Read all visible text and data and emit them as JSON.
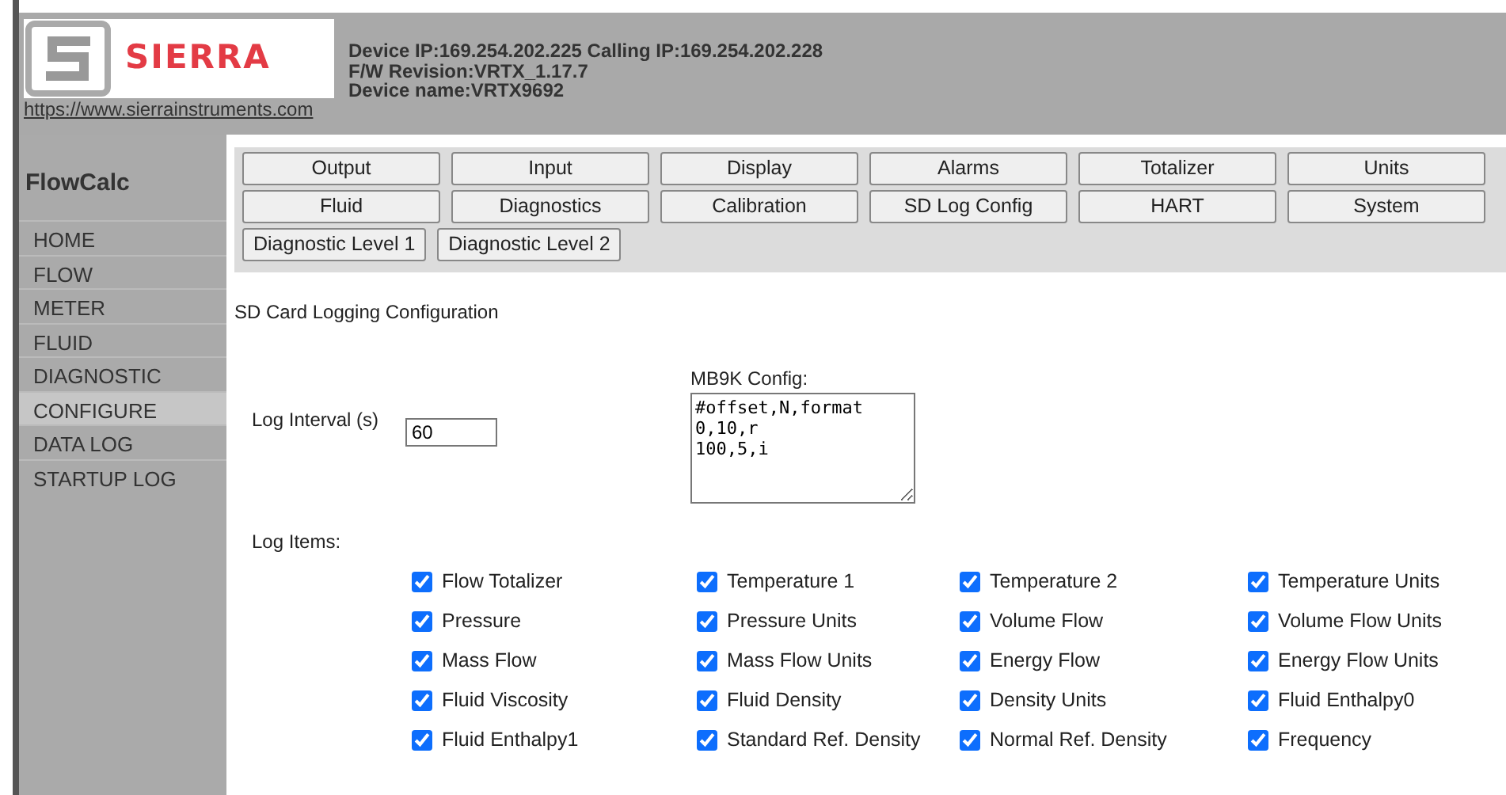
{
  "header": {
    "logo_text": "SIERRA",
    "url": "https://www.sierrainstruments.com",
    "info_lines": [
      "Device IP:169.254.202.225 Calling IP:169.254.202.228",
      "F/W Revision:VRTX_1.17.7",
      "Device name:VRTX9692"
    ]
  },
  "sidebar": {
    "title": "FlowCalc",
    "items": [
      {
        "label": "HOME",
        "selected": false
      },
      {
        "label": "FLOW",
        "selected": false
      },
      {
        "label": "METER",
        "selected": false
      },
      {
        "label": "FLUID",
        "selected": false
      },
      {
        "label": "DIAGNOSTIC",
        "selected": false
      },
      {
        "label": "CONFIGURE",
        "selected": true
      },
      {
        "label": "DATA LOG",
        "selected": false
      },
      {
        "label": "STARTUP LOG",
        "selected": false
      }
    ]
  },
  "menu_rows": [
    [
      "Output",
      "Input",
      "Display",
      "Alarms",
      "Totalizer",
      "Units"
    ],
    [
      "Fluid",
      "Diagnostics",
      "Calibration",
      "SD Log Config",
      "HART",
      "System"
    ],
    [
      "Diagnostic Level 1",
      "Diagnostic Level 2"
    ]
  ],
  "page_title": "SD Card Logging Configuration",
  "log_interval": {
    "label": "Log Interval (s)",
    "value": "60"
  },
  "config": {
    "label": "MB9K Config:",
    "value": "#offset,N,format\n0,10,r\n100,5,i"
  },
  "log_items_label": "Log Items:",
  "log_items": [
    {
      "label": "Flow Totalizer",
      "checked": true
    },
    {
      "label": "Temperature 1",
      "checked": true
    },
    {
      "label": "Temperature 2",
      "checked": true
    },
    {
      "label": "Temperature Units",
      "checked": true
    },
    {
      "label": "Pressure",
      "checked": true
    },
    {
      "label": "Pressure Units",
      "checked": true
    },
    {
      "label": "Volume Flow",
      "checked": true
    },
    {
      "label": "Volume Flow Units",
      "checked": true
    },
    {
      "label": "Mass Flow",
      "checked": true
    },
    {
      "label": "Mass Flow Units",
      "checked": true
    },
    {
      "label": "Energy Flow",
      "checked": true
    },
    {
      "label": "Energy Flow Units",
      "checked": true
    },
    {
      "label": "Fluid Viscosity",
      "checked": true
    },
    {
      "label": "Fluid Density",
      "checked": true
    },
    {
      "label": "Density Units",
      "checked": true
    },
    {
      "label": "Fluid Enthalpy0",
      "checked": true
    },
    {
      "label": "Fluid Enthalpy1",
      "checked": true
    },
    {
      "label": "Standard Ref. Density",
      "checked": true
    },
    {
      "label": "Normal Ref. Density",
      "checked": true
    },
    {
      "label": "Frequency",
      "checked": true
    }
  ]
}
